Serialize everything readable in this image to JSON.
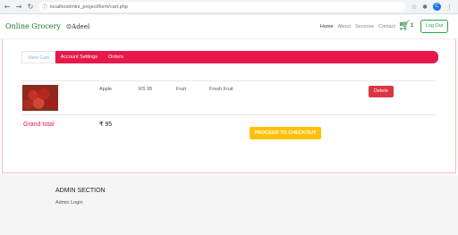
{
  "browser": {
    "url": "localhost/mini_project/form/cart.php",
    "profile_initial": "C"
  },
  "navbar": {
    "brand": "Online Grocery",
    "user": "Adeel",
    "links": [
      "Home",
      "About",
      "Services",
      "Contact"
    ],
    "cart_count": "1",
    "logout_label": "Log Out"
  },
  "tabs": [
    "View Cart",
    "Account Settings",
    "Orders"
  ],
  "cart": {
    "items": [
      {
        "name": "Apple",
        "price": "RS 95",
        "category": "Fruit",
        "type": "Fresh Fruit",
        "action": "Delete"
      }
    ],
    "grand_total_label": "Grand total",
    "grand_total_value": "₹ 95",
    "checkout_label": "PROCEED TO CHECKOUT"
  },
  "footer": {
    "title": "ADMIN SECTION",
    "link": "Admin Login"
  }
}
